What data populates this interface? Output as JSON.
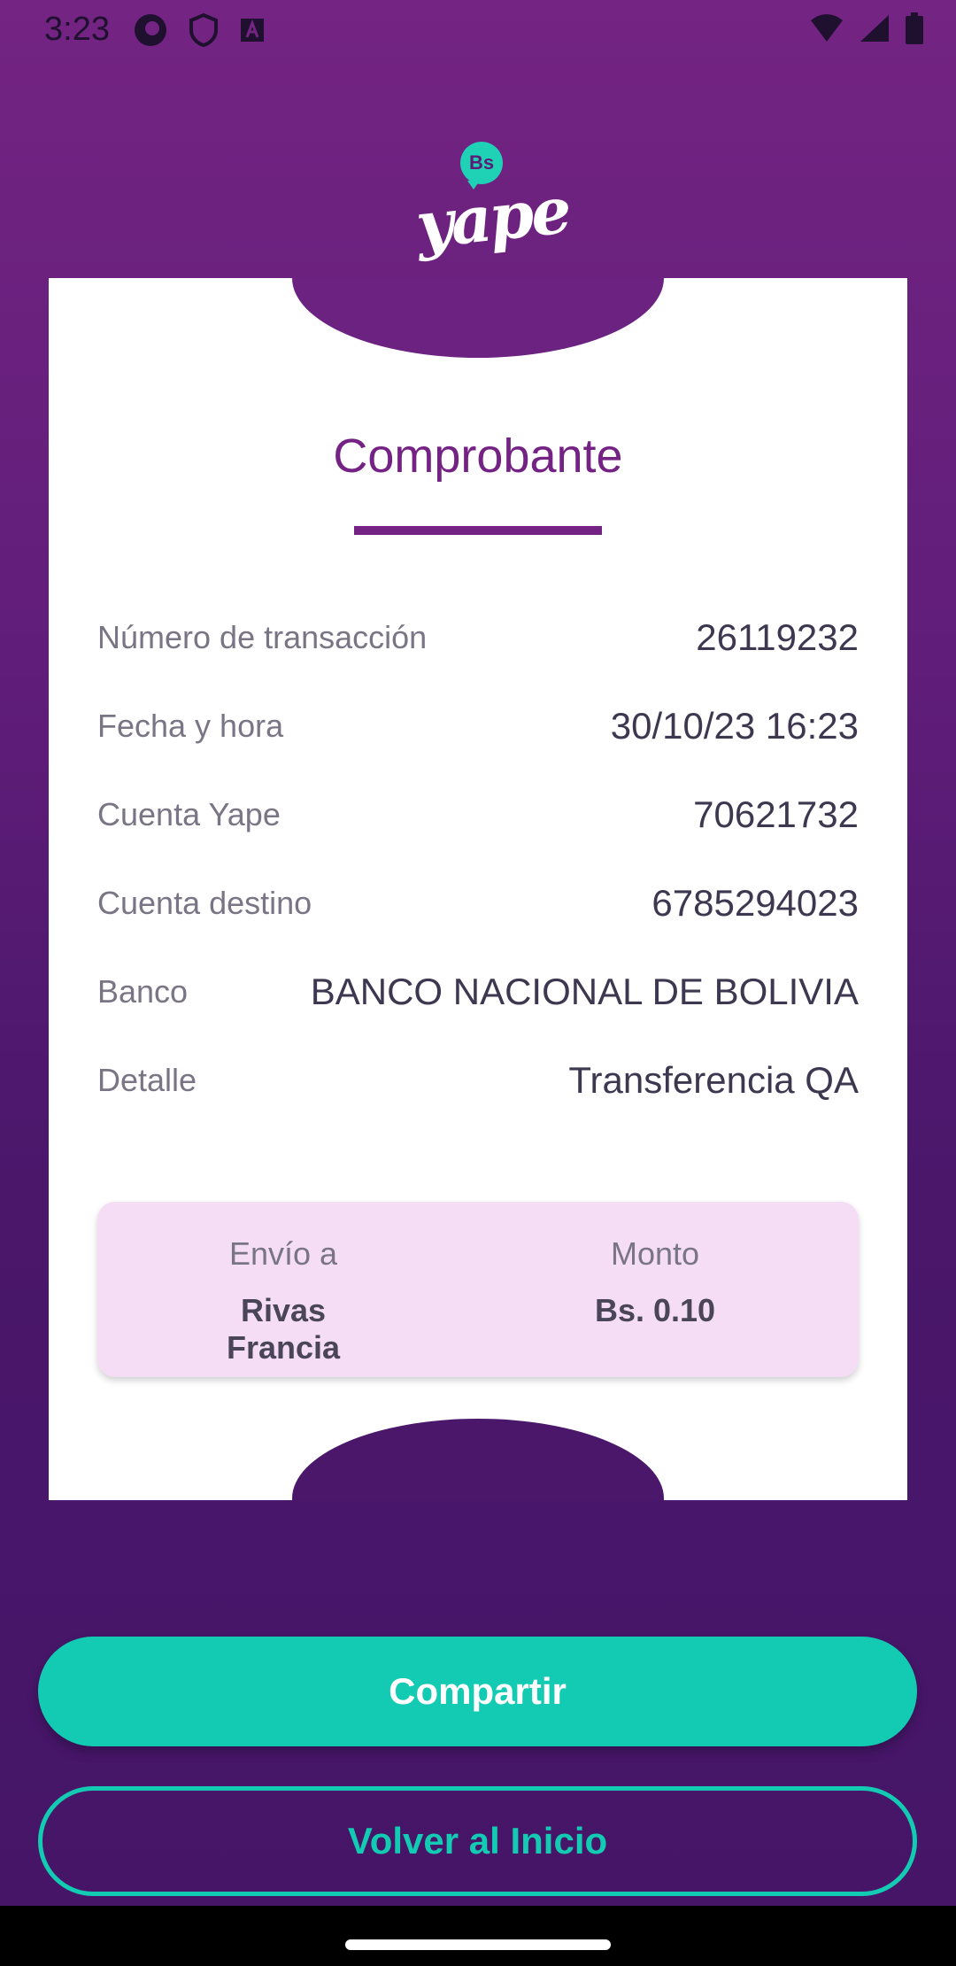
{
  "status_bar": {
    "time": "3:23",
    "left_icons": [
      "refresh-circle-icon",
      "shield-icon",
      "text-badge-icon"
    ],
    "right_icons": [
      "wifi-icon",
      "signal-icon",
      "battery-icon"
    ]
  },
  "brand": {
    "bubble_text": "Bs",
    "wordmark": "yape"
  },
  "receipt": {
    "title": "Comprobante",
    "rows": [
      {
        "label": "Número de transacción",
        "value": "26119232"
      },
      {
        "label": "Fecha y hora",
        "value": "30/10/23 16:23"
      },
      {
        "label": "Cuenta Yape",
        "value": "70621732"
      },
      {
        "label": "Cuenta destino",
        "value": "6785294023"
      },
      {
        "label": "Banco",
        "value": "BANCO NACIONAL DE BOLIVIA"
      },
      {
        "label": "Detalle",
        "value": "Transferencia QA"
      }
    ],
    "summary": {
      "recipient_label": "Envío a",
      "recipient_value": "Rivas Francia",
      "amount_label": "Monto",
      "amount_value": "Bs. 0.10"
    }
  },
  "actions": {
    "share_label": "Compartir",
    "home_label": "Volver al Inicio"
  },
  "colors": {
    "primary_purple": "#742284",
    "accent_teal": "#12cbb2",
    "summary_bg": "#f5def5"
  }
}
